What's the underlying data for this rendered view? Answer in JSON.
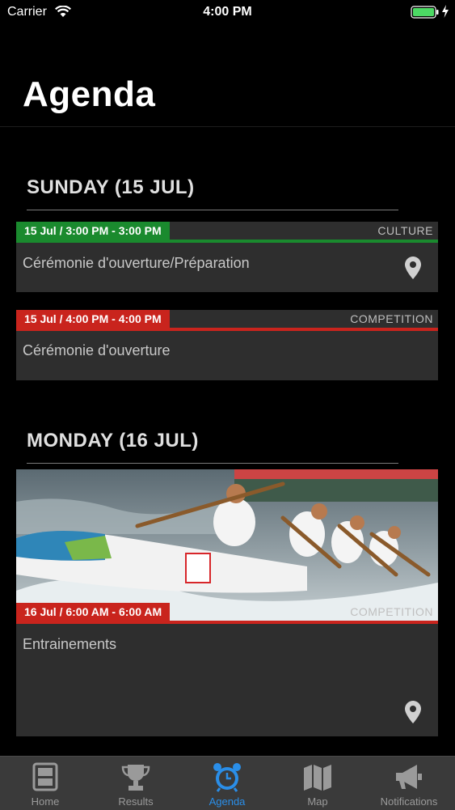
{
  "status_bar": {
    "carrier": "Carrier",
    "time": "4:00 PM"
  },
  "page": {
    "title": "Agenda"
  },
  "sections": [
    {
      "header": "SUNDAY (15 JUL)",
      "events": [
        {
          "date": "15 Jul / 3:00 PM - 3:00 PM",
          "category": "CULTURE",
          "title": "Cérémonie d'ouverture/Préparation",
          "color": "#1a8a2e"
        },
        {
          "date": "15 Jul / 4:00 PM - 4:00 PM",
          "category": "COMPETITION",
          "title": "Cérémonie d'ouverture",
          "color": "#c9241d"
        }
      ]
    },
    {
      "header": "MONDAY (16 JUL)",
      "events": [
        {
          "date": "16 Jul / 6:00 AM - 6:00 AM",
          "category": "COMPETITION",
          "title": "Entrainements",
          "color": "#c9241d"
        }
      ]
    }
  ],
  "tabs": [
    {
      "label": "Home",
      "icon": "home-icon",
      "active": false
    },
    {
      "label": "Results",
      "icon": "trophy-icon",
      "active": false
    },
    {
      "label": "Agenda",
      "icon": "alarm-clock-icon",
      "active": true
    },
    {
      "label": "Map",
      "icon": "map-icon",
      "active": false
    },
    {
      "label": "Notifications",
      "icon": "megaphone-icon",
      "active": false
    }
  ],
  "colors": {
    "accent": "#2a8ee8",
    "tab_inactive": "#9a9a9a",
    "tab_bg": "#3a3a3a",
    "card_bg": "#2e2e2e"
  }
}
